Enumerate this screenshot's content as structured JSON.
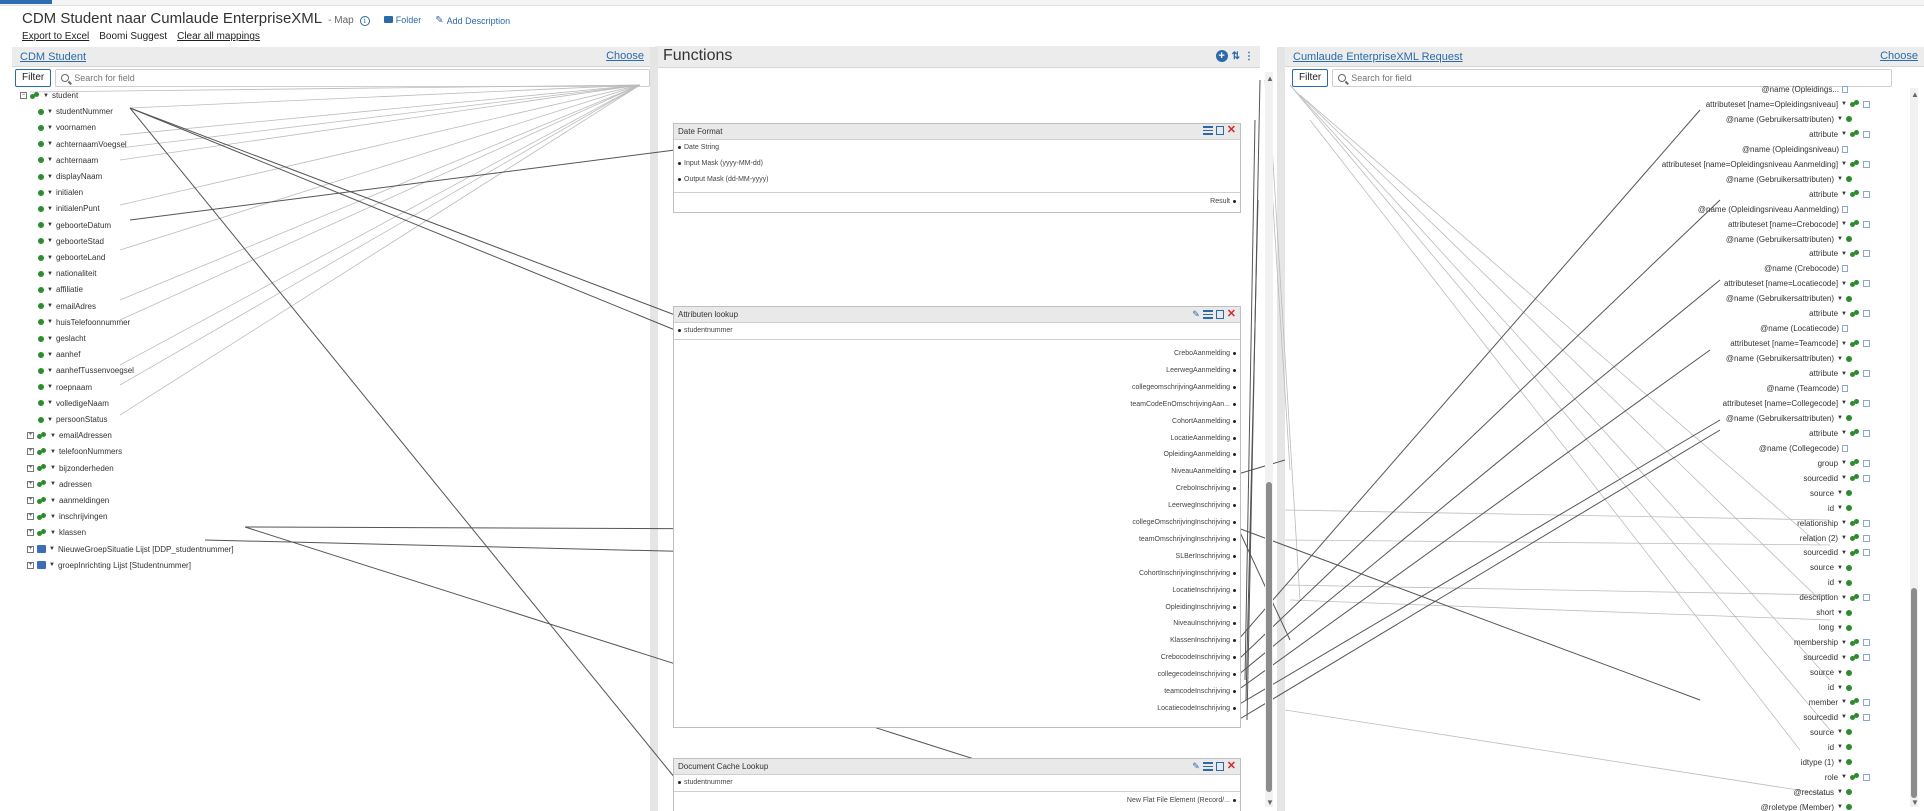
{
  "header": {
    "title": "CDM Student naar Cumlaude EnterpriseXML",
    "type": "- Map",
    "folder_label": "Folder",
    "add_description_label": "Add Description",
    "actions": [
      "Export to Excel",
      "Boomi Suggest",
      "Clear all mappings"
    ]
  },
  "source": {
    "title": "CDM Student",
    "choose_label": "Choose",
    "filter_label": "Filter",
    "search_placeholder": "Search for field",
    "tree": [
      {
        "label": "student",
        "icon": "group",
        "expander": "−",
        "level": 0
      },
      {
        "label": "studentNummer",
        "icon": "leaf",
        "level": 1
      },
      {
        "label": "voornamen",
        "icon": "leaf",
        "level": 1
      },
      {
        "label": "achternaamVoegsel",
        "icon": "leaf",
        "level": 1
      },
      {
        "label": "achternaam",
        "icon": "leaf",
        "level": 1
      },
      {
        "label": "displayNaam",
        "icon": "leaf",
        "level": 1
      },
      {
        "label": "initialen",
        "icon": "leaf",
        "level": 1
      },
      {
        "label": "initialenPunt",
        "icon": "leaf",
        "level": 1
      },
      {
        "label": "geboorteDatum",
        "icon": "leaf",
        "level": 1
      },
      {
        "label": "geboorteStad",
        "icon": "leaf",
        "level": 1
      },
      {
        "label": "geboorteLand",
        "icon": "leaf",
        "level": 1
      },
      {
        "label": "nationaliteit",
        "icon": "leaf",
        "level": 1
      },
      {
        "label": "affiliatie",
        "icon": "leaf",
        "level": 1
      },
      {
        "label": "emailAdres",
        "icon": "leaf",
        "level": 1
      },
      {
        "label": "huisTelefoonnummer",
        "icon": "leaf",
        "level": 1
      },
      {
        "label": "geslacht",
        "icon": "leaf",
        "level": 1
      },
      {
        "label": "aanhef",
        "icon": "leaf",
        "level": 1
      },
      {
        "label": "aanhefTussenvoegsel",
        "icon": "leaf",
        "level": 1
      },
      {
        "label": "roepnaam",
        "icon": "leaf",
        "level": 1
      },
      {
        "label": "volledigeNaam",
        "icon": "leaf",
        "level": 1
      },
      {
        "label": "persoonStatus",
        "icon": "leaf",
        "level": 1
      },
      {
        "label": "emailAdressen",
        "icon": "group",
        "expander": "+",
        "level": 1
      },
      {
        "label": "telefoonNummers",
        "icon": "group",
        "expander": "+",
        "level": 1
      },
      {
        "label": "bijzonderheden",
        "icon": "group",
        "expander": "+",
        "level": 1
      },
      {
        "label": "adressen",
        "icon": "group",
        "expander": "+",
        "level": 1
      },
      {
        "label": "aanmeldingen",
        "icon": "group",
        "expander": "+",
        "level": 1
      },
      {
        "label": "inschrijvingen",
        "icon": "group",
        "expander": "+",
        "level": 1
      },
      {
        "label": "klassen",
        "icon": "group",
        "expander": "+",
        "level": 1
      },
      {
        "label": "NieuweGroepSituatie Lijst [DDP_studentnummer]",
        "icon": "db",
        "expander": "+",
        "level": 1
      },
      {
        "label": "groepInrichting Lijst [Studentnummer]",
        "icon": "db",
        "expander": "+",
        "level": 1
      }
    ]
  },
  "functions": {
    "title": "Functions",
    "date_format": {
      "title": "Date Format",
      "inputs": [
        "Date String",
        "Input Mask (yyyy-MM-dd)",
        "Output Mask (dd-MM-yyyy)"
      ],
      "outputs": [
        "Result"
      ]
    },
    "attributen_lookup": {
      "title": "Attributen lookup",
      "inputs": [
        "studentnummer"
      ],
      "outputs": [
        "CreboAanmelding",
        "LeerwegAanmelding",
        "collegeomschrijvingAanmelding",
        "teamCodeEnOmschrijvingAan...",
        "CohortAanmelding",
        "LocatieAanmelding",
        "OpleidingAanmelding",
        "NiveauAanmelding",
        "CreboInschrijving",
        "LeerwegInschrijving",
        "collegeOmschrijvingInschrijving",
        "teamOmschrijvingInschrijving",
        "SLBerInschrijving",
        "CohortInschrijvingInschrijving",
        "LocatieInschrijving",
        "OpleidingInschrijving",
        "NiveauInschrijving",
        "KlassenInschrijving",
        "CrebocodeInschrijving",
        "collegecodeInschrijving",
        "teamcodeInschrijving",
        "LocatiecodeInschrijving"
      ]
    },
    "document_cache_lookup": {
      "title": "Document Cache Lookup",
      "inputs": [
        "studentnummer"
      ],
      "outputs": [
        "New Flat File Element (Record/..."
      ]
    }
  },
  "destination": {
    "title": "Cumlaude EnterpriseXML Request",
    "choose_label": "Choose",
    "filter_label": "Filter",
    "search_placeholder": "Search for field",
    "tree": [
      {
        "label": "@name (Opleidings...",
        "mark": "doc"
      },
      {
        "label": "attributeset [name=Opleidingsniveau]",
        "mark": "group"
      },
      {
        "label": "@name (Gebruikersattributen)",
        "mark": "leaf"
      },
      {
        "label": "attribute",
        "mark": "group"
      },
      {
        "label": "@name (Opleidingsniveau)",
        "mark": "doc"
      },
      {
        "label": "attributeset [name=Opleidingsniveau Aanmelding]",
        "mark": "group"
      },
      {
        "label": "@name (Gebruikersattributen)",
        "mark": "leaf"
      },
      {
        "label": "attribute",
        "mark": "group"
      },
      {
        "label": "@name (Opleidingsniveau Aanmelding)",
        "mark": "doc"
      },
      {
        "label": "attributeset [name=Crebocode]",
        "mark": "group"
      },
      {
        "label": "@name (Gebruikersattributen)",
        "mark": "leaf"
      },
      {
        "label": "attribute",
        "mark": "group"
      },
      {
        "label": "@name (Crebocode)",
        "mark": "doc"
      },
      {
        "label": "attributeset [name=Locatiecode]",
        "mark": "group"
      },
      {
        "label": "@name (Gebruikersattributen)",
        "mark": "leaf"
      },
      {
        "label": "attribute",
        "mark": "group"
      },
      {
        "label": "@name (Locatiecode)",
        "mark": "doc"
      },
      {
        "label": "attributeset [name=Teamcode]",
        "mark": "group"
      },
      {
        "label": "@name (Gebruikersattributen)",
        "mark": "leaf"
      },
      {
        "label": "attribute",
        "mark": "group"
      },
      {
        "label": "@name (Teamcode)",
        "mark": "doc"
      },
      {
        "label": "attributeset [name=Collegecode]",
        "mark": "group"
      },
      {
        "label": "@name (Gebruikersattributen)",
        "mark": "leaf"
      },
      {
        "label": "attribute",
        "mark": "group"
      },
      {
        "label": "@name (Collegecode)",
        "mark": "doc"
      },
      {
        "label": "group",
        "mark": "group"
      },
      {
        "label": "sourcedid",
        "mark": "group"
      },
      {
        "label": "source",
        "mark": "leaf"
      },
      {
        "label": "id",
        "mark": "leaf"
      },
      {
        "label": "relationship",
        "mark": "group"
      },
      {
        "label": "relation (2)",
        "mark": "group"
      },
      {
        "label": "sourcedid",
        "mark": "group"
      },
      {
        "label": "source",
        "mark": "leaf"
      },
      {
        "label": "id",
        "mark": "leaf"
      },
      {
        "label": "description",
        "mark": "group"
      },
      {
        "label": "short",
        "mark": "leaf"
      },
      {
        "label": "long",
        "mark": "leaf"
      },
      {
        "label": "membership",
        "mark": "group"
      },
      {
        "label": "sourcedid",
        "mark": "group"
      },
      {
        "label": "source",
        "mark": "leaf"
      },
      {
        "label": "id",
        "mark": "leaf"
      },
      {
        "label": "member",
        "mark": "group"
      },
      {
        "label": "sourcedid",
        "mark": "group"
      },
      {
        "label": "source",
        "mark": "leaf"
      },
      {
        "label": "id",
        "mark": "leaf"
      },
      {
        "label": "idtype (1)",
        "mark": "leaf"
      },
      {
        "label": "role",
        "mark": "group"
      },
      {
        "label": "@recstatus",
        "mark": "leaf"
      },
      {
        "label": "@roletype (Member)",
        "mark": "leaf"
      }
    ]
  }
}
